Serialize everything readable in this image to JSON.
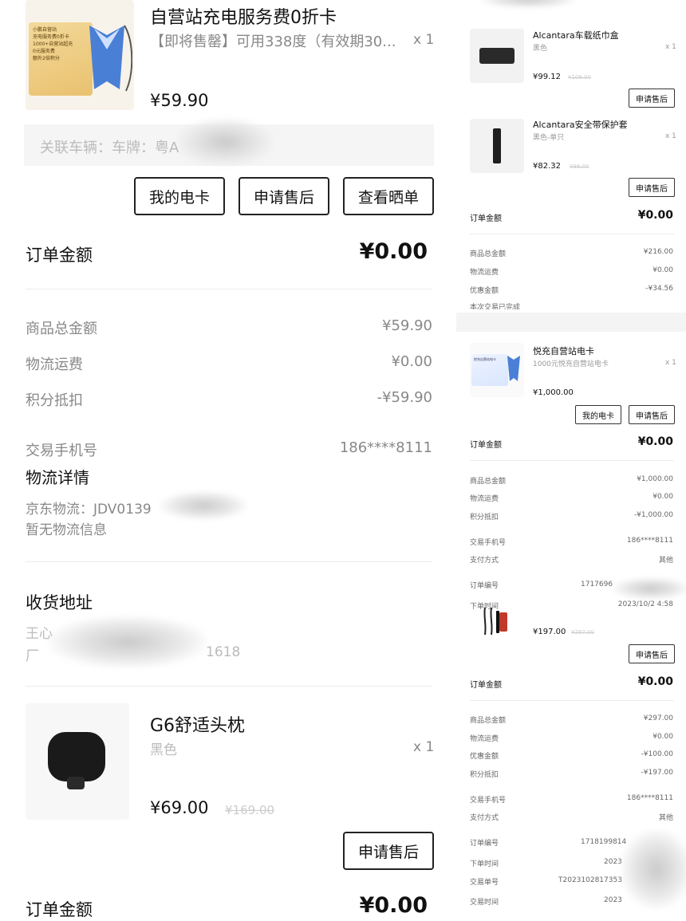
{
  "left": {
    "item1": {
      "title": "自营站充电服务费0折卡",
      "subtitle": "【即将售罄】可用338度（有效期30...",
      "qty": "x 1",
      "price": "¥59.90",
      "card_text": [
        "小鹏自营站",
        "充电服务费0折卡",
        "1000+自营站超充",
        "0元服务费",
        "额外2倍积分"
      ],
      "vehicle_label": "关联车辆：车牌：粤A"
    },
    "buttons1": {
      "my_card": "我的电卡",
      "after_sale": "申请售后",
      "review": "查看晒单"
    },
    "order_amount": {
      "label": "订单金额",
      "value": "¥0.00"
    },
    "summary": [
      {
        "label": "商品总金额",
        "value": "¥59.90"
      },
      {
        "label": "物流运费",
        "value": "¥0.00"
      },
      {
        "label": "积分抵扣",
        "value": "-¥59.90"
      }
    ],
    "phone": {
      "label": "交易手机号",
      "value": "186****8111"
    },
    "logistics": {
      "title": "物流详情",
      "line1": "京东物流：JDV0139",
      "line2": "暂无物流信息"
    },
    "address": {
      "title": "收货地址",
      "name": "王心",
      "line": "厂",
      "tail": "1618"
    },
    "item2": {
      "title": "G6舒适头枕",
      "variant": "黑色",
      "qty": "x 1",
      "price": "¥69.00",
      "original": "¥169.00"
    },
    "buttons2": {
      "after_sale": "申请售后"
    },
    "order_amount2": {
      "label": "订单金额",
      "value": "¥0.00"
    }
  },
  "right": {
    "item_a": {
      "title": "Alcantara车载纸巾盒",
      "variant": "黑色",
      "qty": "x 1",
      "price": "¥99.12",
      "original": "¥108.00",
      "button": "申请售后"
    },
    "item_b": {
      "title": "Alcantara安全带保护套",
      "variant": "黑色-单只",
      "qty": "x 1",
      "price": "¥82.32",
      "original": "¥98.00",
      "button": "申请售后"
    },
    "order1": {
      "label": "订单金额",
      "value": "¥0.00",
      "rows": [
        {
          "label": "商品总金额",
          "value": "¥216.00"
        },
        {
          "label": "物流运费",
          "value": "¥0.00"
        },
        {
          "label": "优惠金额",
          "value": "-¥34.56"
        },
        {
          "label": "本次交易已完成",
          "value": ""
        }
      ]
    },
    "item_c": {
      "title": "悦充自营站电卡",
      "variant": "1000元悦充自营站电卡",
      "qty": "x 1",
      "price": "¥1,000.00",
      "card_text": "悦充自营站电卡",
      "btn_card": "我的电卡",
      "btn_after": "申请售后"
    },
    "order2": {
      "label": "订单金额",
      "value": "¥0.00",
      "rows": [
        {
          "label": "商品总金额",
          "value": "¥1,000.00"
        },
        {
          "label": "物流运费",
          "value": "¥0.00"
        },
        {
          "label": "积分抵扣",
          "value": "-¥1,000.00"
        }
      ],
      "rows2": [
        {
          "label": "交易手机号",
          "value": "186****8111"
        },
        {
          "label": "支付方式",
          "value": "其他"
        },
        {
          "label": "订单编号",
          "value": "1717696"
        },
        {
          "label": "下单时间",
          "value": "2023/10/2   4:58"
        }
      ]
    },
    "item_d": {
      "price": "¥197.00",
      "original": "¥297.00",
      "button": "申请售后"
    },
    "order3": {
      "label": "订单金额",
      "value": "¥0.00",
      "rows": [
        {
          "label": "商品总金额",
          "value": "¥297.00"
        },
        {
          "label": "物流运费",
          "value": "¥0.00"
        },
        {
          "label": "优惠金额",
          "value": "-¥100.00"
        },
        {
          "label": "积分抵扣",
          "value": "-¥197.00"
        }
      ],
      "rows2": [
        {
          "label": "交易手机号",
          "value": "186****8111"
        },
        {
          "label": "支付方式",
          "value": "其他"
        },
        {
          "label": "订单编号",
          "value": "1718199814"
        },
        {
          "label": "下单时间",
          "value": "2023"
        },
        {
          "label": "交易单号",
          "value": "T2023102817353"
        },
        {
          "label": "交易时间",
          "value": "2023"
        }
      ]
    }
  }
}
